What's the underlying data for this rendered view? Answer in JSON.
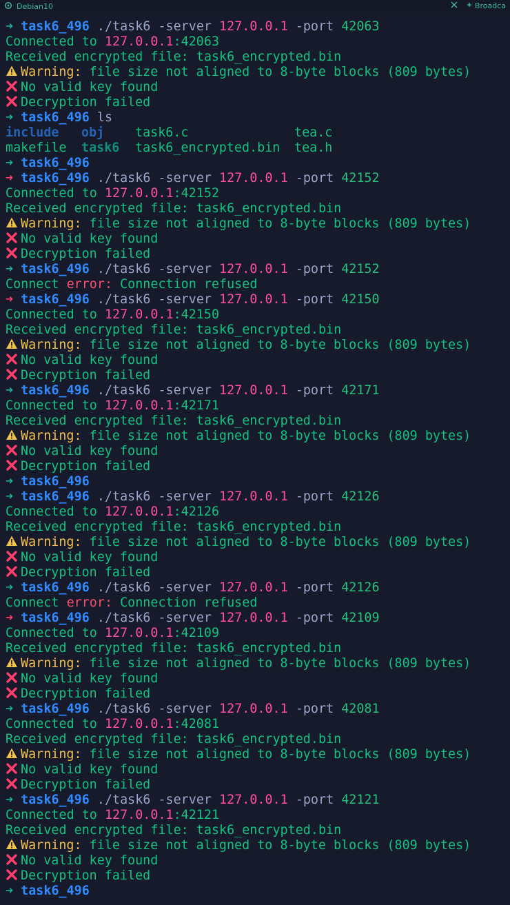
{
  "window": {
    "title": "Debian10",
    "broadcast_label": "Broadca"
  },
  "terminal": {
    "sessions": [
      {
        "arrow": "ok",
        "dir": "task6_496",
        "cmd": " ./task6 -server ",
        "ip": "127.0.0.1",
        "port_flag": " -port ",
        "port": "42063",
        "lines": [
          {
            "t": "connected",
            "a": "Connected to ",
            "b": "127.0.0.1",
            "c": ":42063"
          },
          {
            "t": "received",
            "a": "Received encrypted file: task6_encrypted.bin"
          },
          {
            "t": "warning",
            "a": "Warning:",
            "b": " file size not aligned to 8-byte blocks (809 bytes)"
          },
          {
            "t": "x",
            "a": "No valid key found"
          },
          {
            "t": "x",
            "a": "Decryption failed"
          }
        ]
      },
      {
        "arrow": "ok",
        "dir": "task6_496",
        "cmd": " ls",
        "lines": [
          {
            "t": "ls",
            "cols": [
              "include",
              "obj",
              "task6.c",
              "tea.c"
            ],
            "kinds": [
              "dir",
              "dir",
              "file",
              "file"
            ]
          },
          {
            "t": "ls",
            "cols": [
              "makefile",
              "task6",
              "task6_encrypted.bin",
              "tea.h"
            ],
            "kinds": [
              "file",
              "exe",
              "file",
              "file"
            ]
          }
        ]
      },
      {
        "arrow": "ok",
        "dir": "task6_496",
        "cmd": "",
        "lines": []
      },
      {
        "arrow": "err",
        "dir": "task6_496",
        "cmd": " ./task6 -server ",
        "ip": "127.0.0.1",
        "port_flag": " -port ",
        "port": "42152",
        "lines": [
          {
            "t": "connected",
            "a": "Connected to ",
            "b": "127.0.0.1",
            "c": ":42152"
          },
          {
            "t": "received",
            "a": "Received encrypted file: task6_encrypted.bin"
          },
          {
            "t": "warning",
            "a": "Warning:",
            "b": " file size not aligned to 8-byte blocks (809 bytes)"
          },
          {
            "t": "x",
            "a": "No valid key found"
          },
          {
            "t": "x",
            "a": "Decryption failed"
          }
        ]
      },
      {
        "arrow": "ok",
        "dir": "task6_496",
        "cmd": " ./task6 -server ",
        "ip": "127.0.0.1",
        "port_flag": " -port ",
        "port": "42152",
        "lines": [
          {
            "t": "connerr",
            "a": "Connect ",
            "b": "error:",
            "c": " Connection refused"
          }
        ]
      },
      {
        "arrow": "err",
        "dir": "task6_496",
        "cmd": " ./task6 -server ",
        "ip": "127.0.0.1",
        "port_flag": " -port ",
        "port": "42150",
        "lines": [
          {
            "t": "connected",
            "a": "Connected to ",
            "b": "127.0.0.1",
            "c": ":42150"
          },
          {
            "t": "received",
            "a": "Received encrypted file: task6_encrypted.bin"
          },
          {
            "t": "warning",
            "a": "Warning:",
            "b": " file size not aligned to 8-byte blocks (809 bytes)"
          },
          {
            "t": "x",
            "a": "No valid key found"
          },
          {
            "t": "x",
            "a": "Decryption failed"
          }
        ]
      },
      {
        "arrow": "ok",
        "dir": "task6_496",
        "cmd": " ./task6 -server ",
        "ip": "127.0.0.1",
        "port_flag": " -port ",
        "port": "42171",
        "lines": [
          {
            "t": "connected",
            "a": "Connected to ",
            "b": "127.0.0.1",
            "c": ":42171"
          },
          {
            "t": "received",
            "a": "Received encrypted file: task6_encrypted.bin"
          },
          {
            "t": "warning",
            "a": "Warning:",
            "b": " file size not aligned to 8-byte blocks (809 bytes)"
          },
          {
            "t": "x",
            "a": "No valid key found"
          },
          {
            "t": "x",
            "a": "Decryption failed"
          }
        ]
      },
      {
        "arrow": "ok",
        "dir": "task6_496",
        "cmd": "",
        "lines": []
      },
      {
        "arrow": "ok",
        "dir": "task6_496",
        "cmd": " ./task6 -server ",
        "ip": "127.0.0.1",
        "port_flag": " -port ",
        "port": "42126",
        "lines": [
          {
            "t": "connected",
            "a": "Connected to ",
            "b": "127.0.0.1",
            "c": ":42126"
          },
          {
            "t": "received",
            "a": "Received encrypted file: task6_encrypted.bin"
          },
          {
            "t": "warning",
            "a": "Warning:",
            "b": " file size not aligned to 8-byte blocks (809 bytes)"
          },
          {
            "t": "x",
            "a": "No valid key found"
          },
          {
            "t": "x",
            "a": "Decryption failed"
          }
        ]
      },
      {
        "arrow": "ok",
        "dir": "task6_496",
        "cmd": " ./task6 -server ",
        "ip": "127.0.0.1",
        "port_flag": " -port ",
        "port": "42126",
        "lines": [
          {
            "t": "connerr",
            "a": "Connect ",
            "b": "error:",
            "c": " Connection refused"
          }
        ]
      },
      {
        "arrow": "err",
        "dir": "task6_496",
        "cmd": " ./task6 -server ",
        "ip": "127.0.0.1",
        "port_flag": " -port ",
        "port": "42109",
        "lines": [
          {
            "t": "connected",
            "a": "Connected to ",
            "b": "127.0.0.1",
            "c": ":42109"
          },
          {
            "t": "received",
            "a": "Received encrypted file: task6_encrypted.bin"
          },
          {
            "t": "warning",
            "a": "Warning:",
            "b": " file size not aligned to 8-byte blocks (809 bytes)"
          },
          {
            "t": "x",
            "a": "No valid key found"
          },
          {
            "t": "x",
            "a": "Decryption failed"
          }
        ]
      },
      {
        "arrow": "ok",
        "dir": "task6_496",
        "cmd": " ./task6 -server ",
        "ip": "127.0.0.1",
        "port_flag": " -port ",
        "port": "42081",
        "lines": [
          {
            "t": "connected",
            "a": "Connected to ",
            "b": "127.0.0.1",
            "c": ":42081"
          },
          {
            "t": "received",
            "a": "Received encrypted file: task6_encrypted.bin"
          },
          {
            "t": "warning",
            "a": "Warning:",
            "b": " file size not aligned to 8-byte blocks (809 bytes)"
          },
          {
            "t": "x",
            "a": "No valid key found"
          },
          {
            "t": "x",
            "a": "Decryption failed"
          }
        ]
      },
      {
        "arrow": "ok",
        "dir": "task6_496",
        "cmd": " ./task6 -server ",
        "ip": "127.0.0.1",
        "port_flag": " -port ",
        "port": "42121",
        "lines": [
          {
            "t": "connected",
            "a": "Connected to ",
            "b": "127.0.0.1",
            "c": ":42121"
          },
          {
            "t": "received",
            "a": "Received encrypted file: task6_encrypted.bin"
          },
          {
            "t": "warning",
            "a": "Warning:",
            "b": " file size not aligned to 8-byte blocks (809 bytes)"
          },
          {
            "t": "x",
            "a": "No valid key found"
          },
          {
            "t": "x",
            "a": "Decryption failed"
          }
        ]
      },
      {
        "arrow": "ok",
        "dir": "task6_496",
        "cmd": "",
        "lines": []
      }
    ]
  }
}
